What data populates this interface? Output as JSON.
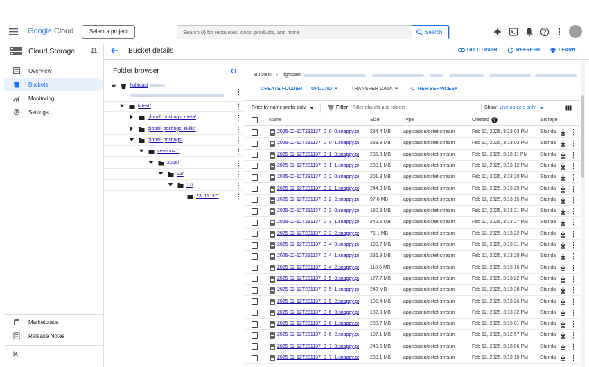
{
  "topbar": {
    "logo": {
      "google": "Google",
      "cloud": "Cloud"
    },
    "project_button": "Select a project",
    "search_placeholder": "Search (/) for resources, docs, products, and more",
    "search_button": "Search",
    "icons": [
      "gemini-icon",
      "terminal-icon",
      "bell-icon",
      "help-icon",
      "more-vert-icon",
      "avatar"
    ]
  },
  "sidebar": {
    "title": "Cloud Storage",
    "items": [
      {
        "label": "Overview",
        "icon": "overview-icon"
      },
      {
        "label": "Buckets",
        "icon": "bucket-icon",
        "active": true
      },
      {
        "label": "Monitoring",
        "icon": "monitoring-icon"
      },
      {
        "label": "Settings",
        "icon": "gear-icon"
      }
    ],
    "bottom_items": [
      {
        "label": "Marketplace",
        "icon": "marketplace-icon"
      },
      {
        "label": "Release Notes",
        "icon": "notes-icon"
      }
    ]
  },
  "header": {
    "title": "Bucket details",
    "links": [
      {
        "label": "GO TO PATH",
        "icon": "link-icon"
      },
      {
        "label": "REFRESH",
        "icon": "refresh-icon"
      },
      {
        "label": "LEARN",
        "icon": "school-icon"
      }
    ]
  },
  "folder_browser": {
    "title": "Folder browser",
    "bucket": "lightcast",
    "folders": [
      {
        "name": "latest/",
        "level": 1,
        "expanded": true
      },
      {
        "name": "global_postings_meta/",
        "level": 2,
        "expanded": false
      },
      {
        "name": "global_postings_skills/",
        "level": 2,
        "expanded": false
      },
      {
        "name": "global_postings/",
        "level": 2,
        "expanded": true
      },
      {
        "name": "version=1/",
        "level": 3,
        "expanded": true
      },
      {
        "name": "2025/",
        "level": 4,
        "expanded": true
      },
      {
        "name": "02/",
        "level": 5,
        "expanded": true
      },
      {
        "name": "12/",
        "level": 6,
        "expanded": true
      },
      {
        "name": "23_11_37/",
        "level": 7,
        "expanded": null
      }
    ]
  },
  "breadcrumb": {
    "root": "Buckets",
    "bucket": "lightcast"
  },
  "actions": [
    "CREATE FOLDER",
    "UPLOAD",
    "TRANSFER DATA",
    "OTHER SERVICES"
  ],
  "filterbar": {
    "prefix_label": "Filter by name prefix only",
    "filter_label": "Filter",
    "filter_placeholder": "Filter objects and folders",
    "show_label": "Show",
    "show_value": "Live objects only"
  },
  "table": {
    "headers": {
      "name": "Name",
      "size": "Size",
      "type": "Type",
      "created": "Created",
      "storage": "Storage"
    },
    "rows": [
      {
        "name": "2025-02-12T231137_0_0_0.snappy.parquet",
        "size": "234.4 MB",
        "type": "application/octet-stream",
        "created": "Feb 12, 2025, 3:13:03 PM",
        "storage": "Standard"
      },
      {
        "name": "2025-02-12T231137_0_0_1.snappy.parquet",
        "size": "238.3 MB",
        "type": "application/octet-stream",
        "created": "Feb 12, 2025, 3:13:03 PM",
        "storage": "Standard"
      },
      {
        "name": "2025-02-12T231137_0_1_0.snappy.parquet",
        "size": "235.3 MB",
        "type": "application/octet-stream",
        "created": "Feb 12, 2025, 3:13:11 PM",
        "storage": "Standard"
      },
      {
        "name": "2025-02-12T231137_0_1_1.snappy.parquet",
        "size": "238.1 MB",
        "type": "application/octet-stream",
        "created": "Feb 12, 2025, 3:13:12 PM",
        "storage": "Standard"
      },
      {
        "name": "2025-02-12T231137_0_2_0.snappy.parquet",
        "size": "201.3 MB",
        "type": "application/octet-stream",
        "created": "Feb 12, 2025, 3:13:20 PM",
        "storage": "Standard"
      },
      {
        "name": "2025-02-12T231137_0_2_1.snappy.parquet",
        "size": "244.3 MB",
        "type": "application/octet-stream",
        "created": "Feb 12, 2025, 3:13:29 PM",
        "storage": "Standard"
      },
      {
        "name": "2025-02-12T231137_0_2_2.snappy.parquet",
        "size": "97.6 MB",
        "type": "application/octet-stream",
        "created": "Feb 12, 2025, 3:13:15 PM",
        "storage": "Standard"
      },
      {
        "name": "2025-02-12T231137_0_3_0.snappy.parquet",
        "size": "180.3 MB",
        "type": "application/octet-stream",
        "created": "Feb 12, 2025, 3:13:21 PM",
        "storage": "Standard"
      },
      {
        "name": "2025-02-12T231137_0_3_1.snappy.parquet",
        "size": "242.6 MB",
        "type": "application/octet-stream",
        "created": "Feb 12, 2025, 3:13:27 PM",
        "storage": "Standard"
      },
      {
        "name": "2025-02-12T231137_0_3_2.snappy.parquet",
        "size": "76.1 MB",
        "type": "application/octet-stream",
        "created": "Feb 12, 2025, 3:13:22 PM",
        "storage": "Standard"
      },
      {
        "name": "2025-02-12T231137_0_4_0.snappy.parquet",
        "size": "190.7 MB",
        "type": "application/octet-stream",
        "created": "Feb 12, 2025, 3:13:31 PM",
        "storage": "Standard"
      },
      {
        "name": "2025-02-12T231137_0_4_1.snappy.parquet",
        "size": "236.9 MB",
        "type": "application/octet-stream",
        "created": "Feb 12, 2025, 3:13:20 PM",
        "storage": "Standard"
      },
      {
        "name": "2025-02-12T231137_0_4_2.snappy.parquet",
        "size": "118.6 MB",
        "type": "application/octet-stream",
        "created": "Feb 12, 2025, 3:13:16 PM",
        "storage": "Standard"
      },
      {
        "name": "2025-02-12T231137_0_5_0.snappy.parquet",
        "size": "177.7 MB",
        "type": "application/octet-stream",
        "created": "Feb 12, 2025, 3:13:22 PM",
        "storage": "Standard"
      },
      {
        "name": "2025-02-12T231137_0_5_1.snappy.parquet",
        "size": "240 MB",
        "type": "application/octet-stream",
        "created": "Feb 12, 2025, 3:13:30 PM",
        "storage": "Standard"
      },
      {
        "name": "2025-02-12T231137_0_5_2.snappy.parquet",
        "size": "105.4 MB",
        "type": "application/octet-stream",
        "created": "Feb 12, 2025, 3:13:26 PM",
        "storage": "Standard"
      },
      {
        "name": "2025-02-12T231137_0_6_0.snappy.parquet",
        "size": "182.8 MB",
        "type": "application/octet-stream",
        "created": "Feb 12, 2025, 3:13:32 PM",
        "storage": "Standard"
      },
      {
        "name": "2025-02-12T231137_0_6_1.snappy.parquet",
        "size": "238.7 MB",
        "type": "application/octet-stream",
        "created": "Feb 12, 2025, 3:13:01 PM",
        "storage": "Standard"
      },
      {
        "name": "2025-02-12T231137_0_6_2.snappy.parquet",
        "size": "107.1 MB",
        "type": "application/octet-stream",
        "created": "Feb 12, 2025, 3:12:57 PM",
        "storage": "Standard"
      },
      {
        "name": "2025-02-12T231137_0_7_0.snappy.parquet",
        "size": "240.6 MB",
        "type": "application/octet-stream",
        "created": "Feb 12, 2025, 3:13:06 PM",
        "storage": "Standard"
      },
      {
        "name": "2025-02-12T231137_0_7_1.snappy.parquet",
        "size": "239.1 MB",
        "type": "application/octet-stream",
        "created": "Feb 12, 2025, 3:13:10 PM",
        "storage": "Standard"
      }
    ]
  },
  "colors": {
    "accent": "#1a73e8",
    "link": "#1a0dab",
    "active_bg": "#e8f0fe",
    "border": "#dadce0"
  }
}
